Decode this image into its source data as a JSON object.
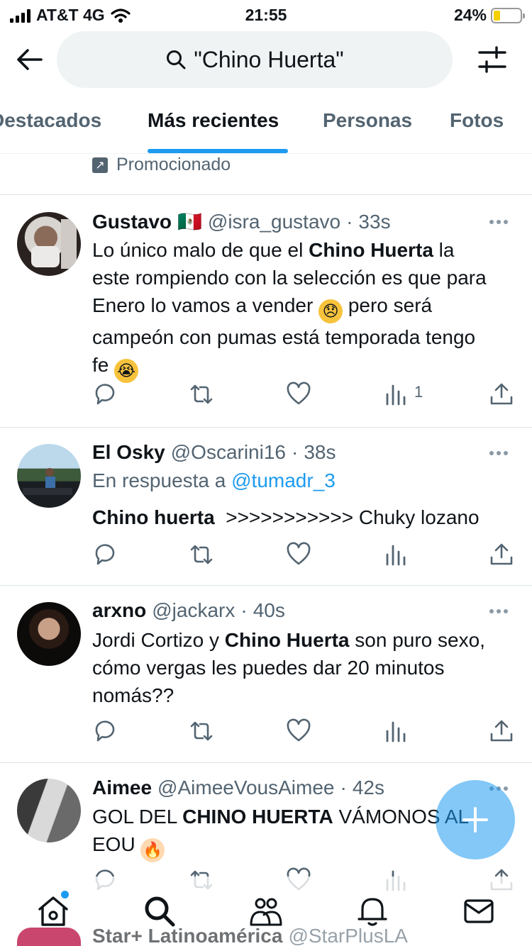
{
  "status_bar": {
    "carrier": "AT&T 4G",
    "time": "21:55",
    "battery": "24%",
    "battery_level": 0.24
  },
  "search": {
    "query": "\"Chino Huerta\""
  },
  "tabs": [
    {
      "label": "Destacados",
      "active": false
    },
    {
      "label": "Más recientes",
      "active": true
    },
    {
      "label": "Personas",
      "active": false
    },
    {
      "label": "Fotos",
      "active": false
    }
  ],
  "promoted_label": "Promocionado",
  "tweets": [
    {
      "name": "Gustavo",
      "flag": "🇲🇽",
      "handle": "@isra_gustavo",
      "time": "33s",
      "text_lines": [
        {
          "pre": "Lo único malo de que el ",
          "bold": "Chino Huerta",
          "post": " la"
        },
        {
          "pre": "este rompiendo con la selección es que para",
          "bold": "",
          "post": ""
        },
        {
          "pre": "Enero lo vamos a vender ",
          "emoji": "😞",
          "post": " pero será"
        },
        {
          "pre": "campeón con pumas está temporada tengo",
          "bold": "",
          "post": ""
        },
        {
          "pre": "fe ",
          "emoji": "😭",
          "post": ""
        }
      ],
      "views": "1"
    },
    {
      "name": "El Osky",
      "handle": "@Oscarini16",
      "time": "38s",
      "reply_prefix": "En respuesta a",
      "reply_to": "@tumadr_3",
      "text_bold": "Chino huerta",
      "text_post": "  >>>>>>>>>>> Chuky lozano"
    },
    {
      "name": "arxno",
      "handle": "@jackarx",
      "time": "40s",
      "text_lines": [
        {
          "pre": "Jordi Cortizo y ",
          "bold": "Chino Huerta",
          "post": " son puro sexo,"
        },
        {
          "pre": "cómo vergas les puedes dar 20 minutos",
          "bold": "",
          "post": ""
        },
        {
          "pre": "nomás??",
          "bold": "",
          "post": ""
        }
      ]
    },
    {
      "name": "Aimee",
      "handle": "@AimeeVousAimee",
      "time": "42s",
      "text_lines": [
        {
          "pre": "GOL DEL ",
          "bold": "CHINO HUERTA",
          "post": " VÁMONOS AL"
        },
        {
          "pre": "EOU ",
          "emoji": "🔥",
          "post": ""
        }
      ]
    }
  ],
  "next_tweet": {
    "name": "Star+ Latinoamérica",
    "handle": "@StarPlusLA"
  },
  "colors": {
    "accent": "#1d9bf0",
    "text": "#0f1419",
    "muted": "#536471"
  },
  "nav_items": [
    "home-icon",
    "search-icon",
    "communities-icon",
    "notifications-icon",
    "messages-icon"
  ]
}
